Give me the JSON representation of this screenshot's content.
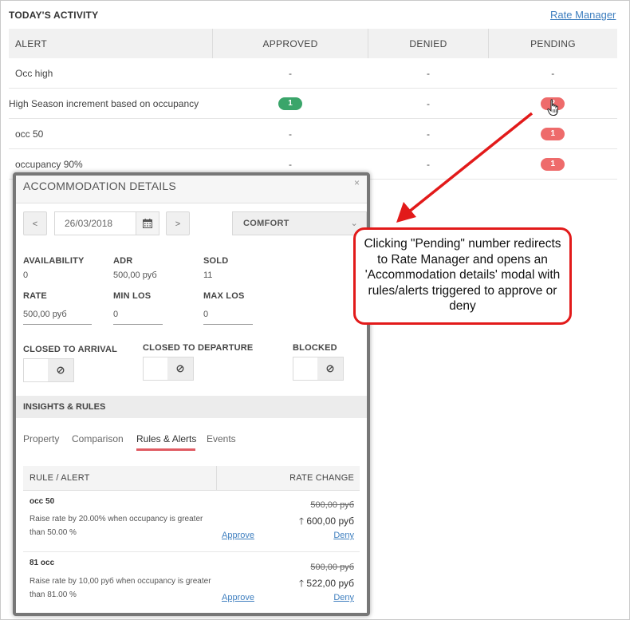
{
  "activity": {
    "title": "TODAY'S ACTIVITY",
    "rate_manager_link": "Rate Manager",
    "columns": [
      "ALERT",
      "APPROVED",
      "DENIED",
      "PENDING"
    ],
    "rows": [
      {
        "alert": "Occ high",
        "approved": "-",
        "denied": "-",
        "pending": "-"
      },
      {
        "alert": "High Season increment based on occupancy",
        "approved": "1",
        "denied": "-",
        "pending": "2"
      },
      {
        "alert": "occ 50",
        "approved": "-",
        "denied": "-",
        "pending": "1"
      },
      {
        "alert": "occupancy 90%",
        "approved": "-",
        "denied": "-",
        "pending": "1"
      }
    ]
  },
  "modal": {
    "title": "ACCOMMODATION DETAILS",
    "close": "×",
    "prev_label": "<",
    "next_label": ">",
    "date_value": "26/03/2018",
    "room_type": "COMFORT",
    "stats": {
      "availability_label": "AVAILABILITY",
      "availability_value": "0",
      "adr_label": "ADR",
      "adr_value": "500,00 руб",
      "sold_label": "SOLD",
      "sold_value": "11"
    },
    "fields": {
      "rate_label": "RATE",
      "rate_value": "500,00 руб",
      "min_los_label": "MIN LOS",
      "min_los_value": "0",
      "max_los_label": "MAX LOS",
      "max_los_value": "0"
    },
    "toggles": {
      "closed_to_arrival": "CLOSED TO ARRIVAL",
      "closed_to_departure": "CLOSED TO DEPARTURE",
      "blocked": "BLOCKED"
    },
    "section_title": "INSIGHTS & RULES",
    "tabs": [
      {
        "label": "Property"
      },
      {
        "label": "Comparison"
      },
      {
        "label": "Rules & Alerts"
      },
      {
        "label": "Events"
      }
    ],
    "active_tab": "Rules & Alerts",
    "rules_table": {
      "col_rule": "RULE / ALERT",
      "col_rate": "RATE CHANGE",
      "rules": [
        {
          "name": "occ 50",
          "description": "Raise rate by 20.00% when occupancy is greater than 50.00 %",
          "old_rate": "500,00 руб",
          "new_rate": "600,00 руб",
          "approve": "Approve",
          "deny": "Deny"
        },
        {
          "name": "81 occ",
          "description": "Raise rate by 10,00 руб when occupancy is greater than 81.00 %",
          "old_rate": "500,00 руб",
          "new_rate": "522,00 руб",
          "approve": "Approve",
          "deny": "Deny"
        }
      ]
    }
  },
  "annotation": {
    "text": "Clicking \"Pending\" number redirects to Rate Manager and opens an 'Accommodation details' modal with rules/alerts triggered to approve or deny",
    "color": "#e21a1a"
  },
  "colors": {
    "approved_pill": "#3aa56a",
    "pending_pill": "#ee6b6b",
    "link": "#3f7fbf",
    "active_tab_underline": "#e05a62"
  }
}
